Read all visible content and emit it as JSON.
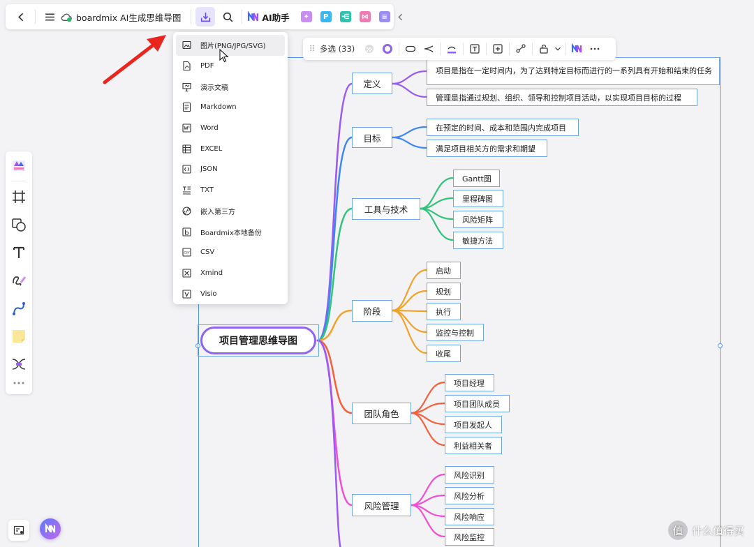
{
  "toolbar": {
    "doc_title": "boardmix AI生成思维导图",
    "ai_label": "AI助手",
    "mini_apps": [
      {
        "icon": "image-gen-icon",
        "color": "#c98ef0",
        "glyph": "✦"
      },
      {
        "icon": "presentation-p-icon",
        "color": "#38b8f2",
        "glyph": "P"
      },
      {
        "icon": "mindmap-app-icon",
        "color": "#2fc3b0",
        "glyph": "⋲"
      },
      {
        "icon": "flow-app-icon",
        "color": "#f07bb3",
        "glyph": "⋈"
      },
      {
        "icon": "chat-app-icon",
        "color": "#9c8cf6",
        "glyph": "≡"
      }
    ]
  },
  "export_menu": {
    "items": [
      {
        "label": "图片(PNG/JPG/SVG)",
        "icon": "image-icon"
      },
      {
        "label": "PDF",
        "icon": "pdf-icon"
      },
      {
        "label": "演示文稿",
        "icon": "presentation-icon"
      },
      {
        "label": "Markdown",
        "icon": "markdown-icon"
      },
      {
        "label": "Word",
        "icon": "word-icon"
      },
      {
        "label": "EXCEL",
        "icon": "excel-icon"
      },
      {
        "label": "JSON",
        "icon": "json-icon"
      },
      {
        "label": "TXT",
        "icon": "txt-icon"
      },
      {
        "label": "嵌入第三方",
        "icon": "embed-icon"
      },
      {
        "label": "Boardmix本地备份",
        "icon": "backup-icon"
      },
      {
        "label": "CSV",
        "icon": "csv-icon"
      },
      {
        "label": "Xmind",
        "icon": "xmind-icon"
      },
      {
        "label": "Visio",
        "icon": "visio-icon"
      }
    ]
  },
  "selection_toolbar": {
    "label": "多选 (33)"
  },
  "mindmap": {
    "root": "项目管理思维导图",
    "branches": [
      {
        "label": "定义",
        "color": "#9a5cf0",
        "children": [
          "项目是指在一定时间内，为了达到特定目标而进行的一系列具有开始和结束的任务",
          "管理是指通过规划、组织、领导和控制项目活动，以实现项目目标的过程"
        ]
      },
      {
        "label": "目标",
        "color": "#3f86f0",
        "children": [
          "在预定的时间、成本和范围内完成项目",
          "满足项目相关方的需求和期望"
        ]
      },
      {
        "label": "工具与技术",
        "color": "#33c27a",
        "children": [
          "Gantt图",
          "里程碑图",
          "风险矩阵",
          "敏捷方法"
        ]
      },
      {
        "label": "阶段",
        "color": "#f1a22a",
        "children": [
          "启动",
          "规划",
          "执行",
          "监控与控制",
          "收尾"
        ]
      },
      {
        "label": "团队角色",
        "color": "#f2603c",
        "children": [
          "项目经理",
          "项目团队成员",
          "项目发起人",
          "利益相关者"
        ]
      },
      {
        "label": "风险管理",
        "color": "#ef4fd6",
        "children": [
          "风险识别",
          "风险分析",
          "风险响应",
          "风险监控"
        ]
      }
    ]
  },
  "watermark": {
    "text": "什么值得买",
    "logo_glyph": "值"
  }
}
